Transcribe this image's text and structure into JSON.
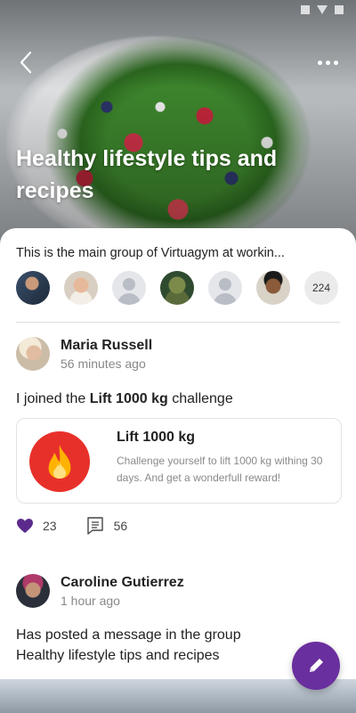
{
  "hero": {
    "title": "Healthy lifestyle tips and recipes",
    "back_icon": "chevron-left-icon",
    "more_icon": "more-horizontal-icon"
  },
  "group": {
    "description": "This is the main group of Virtuagym at workin...",
    "member_count": "224",
    "members": [
      {
        "type": "photo"
      },
      {
        "type": "photo"
      },
      {
        "type": "placeholder"
      },
      {
        "type": "photo"
      },
      {
        "type": "placeholder"
      },
      {
        "type": "photo"
      }
    ]
  },
  "posts": [
    {
      "author": "Maria Russell",
      "time": "56 minutes ago",
      "text_prefix": "I joined the ",
      "text_bold": "Lift 1000 kg",
      "text_suffix": " challenge",
      "challenge": {
        "title": "Lift 1000 kg",
        "description": "Challenge yourself to lift 1000 kg withing 30 days. And get a wonderfull reward!",
        "icon": "flame-icon",
        "icon_color": "#e8302a"
      },
      "likes": "23",
      "comments": "56"
    },
    {
      "author": "Caroline Gutierrez",
      "time": "1 hour ago",
      "text_line1": "Has posted a message in the group",
      "text_line2": "Healthy lifestyle tips and recipes"
    }
  ],
  "colors": {
    "accent": "#6a2f9e",
    "like": "#5b2a8c",
    "flame_bg": "#e8302a",
    "flame_fg": "#ffb300"
  },
  "fab": {
    "icon": "pencil-icon"
  }
}
